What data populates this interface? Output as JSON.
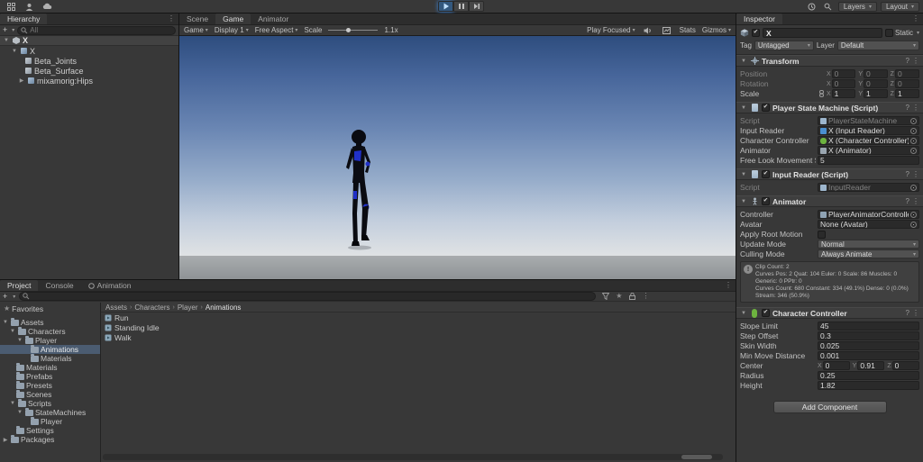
{
  "icons": {
    "check": "✔",
    "dropdown": "▾",
    "kebab": "⋮",
    "foldout_open": "▼",
    "foldout_closed": "▶",
    "breadcrumb_sep": "›",
    "star": "★",
    "plus": "+",
    "help": "?",
    "axis_x": "X",
    "axis_y": "Y",
    "axis_z": "Z"
  },
  "colors": {
    "accent": "#3f8ae0",
    "selection": "#4b5c71",
    "capsule_green": "#6db33f"
  },
  "topbar": {
    "layers": "Layers",
    "layout": "Layout"
  },
  "hierarchy": {
    "tab": "Hierarchy",
    "search_placeholder": "All",
    "scene_name": "X",
    "items": [
      {
        "label": "X"
      },
      {
        "label": "Beta_Joints"
      },
      {
        "label": "Beta_Surface"
      },
      {
        "label": "mixamorig:Hips"
      }
    ]
  },
  "center": {
    "tab_scene": "Scene",
    "tab_game": "Game",
    "tab_animator": "Animator",
    "toolbar": {
      "game": "Game",
      "display": "Display 1",
      "aspect": "Free Aspect",
      "scale_label": "Scale",
      "scale_value": "1.1x",
      "play_focused": "Play Focused",
      "stats": "Stats",
      "gizmos": "Gizmos"
    }
  },
  "project": {
    "tab_project": "Project",
    "tab_console": "Console",
    "tab_animation": "Animation",
    "favorites": "Favorites",
    "tree": [
      {
        "label": "Assets"
      },
      {
        "label": "Characters"
      },
      {
        "label": "Player"
      },
      {
        "label": "Animations"
      },
      {
        "label": "Materials"
      },
      {
        "label": "Materials"
      },
      {
        "label": "Prefabs"
      },
      {
        "label": "Presets"
      },
      {
        "label": "Scenes"
      },
      {
        "label": "Scripts"
      },
      {
        "label": "StateMachines"
      },
      {
        "label": "Player"
      },
      {
        "label": "Settings"
      },
      {
        "label": "Packages"
      }
    ],
    "breadcrumb": [
      "Assets",
      "Characters",
      "Player",
      "Animations"
    ],
    "files": [
      "Run",
      "Standing Idle",
      "Walk"
    ]
  },
  "inspector": {
    "tab": "Inspector",
    "name": "X",
    "static_label": "Static",
    "tag_label": "Tag",
    "tag_value": "Untagged",
    "layer_label": "Layer",
    "layer_value": "Default",
    "transform": {
      "title": "Transform",
      "position_label": "Position",
      "rotation_label": "Rotation",
      "scale_label": "Scale",
      "position": {
        "x": "0",
        "y": "0",
        "z": "0"
      },
      "rotation": {
        "x": "0",
        "y": "0",
        "z": "0"
      },
      "scale": {
        "x": "1",
        "y": "1",
        "z": "1"
      }
    },
    "psm": {
      "title": "Player State Machine (Script)",
      "script_label": "Script",
      "script_value": "PlayerStateMachine",
      "input_reader_label": "Input Reader",
      "input_reader_value": "X (Input Reader)",
      "char_controller_label": "Character Controller",
      "char_controller_value": "X (Character Controller)",
      "animator_label": "Animator",
      "animator_value": "X (Animator)",
      "speed_label": "Free Look Movement Sp",
      "speed_value": "5"
    },
    "input_reader": {
      "title": "Input Reader (Script)",
      "script_label": "Script",
      "script_value": "InputReader"
    },
    "animator": {
      "title": "Animator",
      "controller_label": "Controller",
      "controller_value": "PlayerAnimatorController",
      "avatar_label": "Avatar",
      "avatar_value": "None (Avatar)",
      "root_motion_label": "Apply Root Motion",
      "update_label": "Update Mode",
      "update_value": "Normal",
      "culling_label": "Culling Mode",
      "culling_value": "Always Animate",
      "info_lines": [
        "Clip Count: 2",
        "Curves Pos: 2 Quat: 104 Euler: 0 Scale: 86 Muscles: 0 Generic: 0 PPtr: 0",
        "Curves Count: 680 Constant: 334 (49.1%) Dense: 0 (0.0%) Stream: 346 (50.9%)"
      ]
    },
    "char_controller": {
      "title": "Character Controller",
      "slope_label": "Slope Limit",
      "slope_value": "45",
      "step_label": "Step Offset",
      "step_value": "0.3",
      "skin_label": "Skin Width",
      "skin_value": "0.025",
      "minmove_label": "Min Move Distance",
      "minmove_value": "0.001",
      "center_label": "Center",
      "center": {
        "x": "0",
        "y": "0.91",
        "z": "0"
      },
      "radius_label": "Radius",
      "radius_value": "0.25",
      "height_label": "Height",
      "height_value": "1.82"
    },
    "add_component": "Add Component"
  }
}
